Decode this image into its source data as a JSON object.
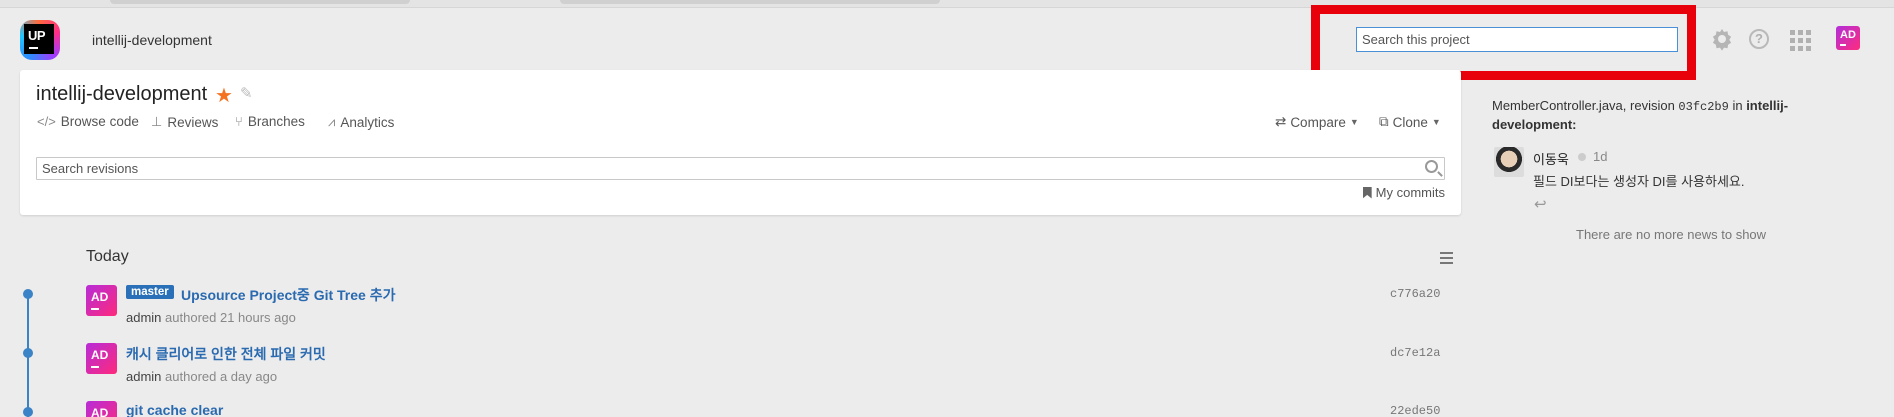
{
  "header": {
    "project_name": "intellij-development",
    "search_placeholder": "Search this project",
    "help_glyph": "?",
    "user_initials": "AD",
    "icons": [
      "upsource-logo",
      "settings-icon",
      "help-icon",
      "apps-grid-icon"
    ]
  },
  "project": {
    "title": "intellij-development",
    "nav": [
      {
        "label": "Browse code",
        "icon": "code-icon"
      },
      {
        "label": "Reviews",
        "icon": "reviews-icon"
      },
      {
        "label": "Branches",
        "icon": "branch-icon"
      },
      {
        "label": "Analytics",
        "icon": "analytics-icon"
      }
    ],
    "compare_label": "Compare",
    "clone_label": "Clone",
    "revision_search_placeholder": "Search revisions",
    "my_commits_label": "My commits"
  },
  "news": {
    "file": "MemberController.java",
    "revision_word": ", revision ",
    "revision": "03fc2b9",
    "in_word": " in ",
    "project": "intellij-development:",
    "author": "이동욱",
    "time": "1d",
    "comment": "필드 DI보다는 생성자 DI를 사용하세요.",
    "empty_text": "There are no more news to show"
  },
  "timeline": {
    "group_label": "Today",
    "commits": [
      {
        "initials": "AD",
        "branch": "master",
        "title": "Upsource Project중 Git Tree 추가",
        "author": "admin",
        "meta": " authored 21 hours ago",
        "hash": "c776a20"
      },
      {
        "initials": "AD",
        "branch": "",
        "title": "캐시 클리어로 인한 전체 파일 커밋",
        "author": "admin",
        "meta": " authored a day ago",
        "hash": "dc7e12a"
      },
      {
        "initials": "AD",
        "branch": "",
        "title": "git cache clear",
        "author": "",
        "meta": "",
        "hash": "22ede50"
      }
    ]
  },
  "colors": {
    "accent": "#2a6ab0",
    "highlight_box": "#e8000b",
    "star": "#f47321",
    "avatar_gradient": [
      "#b62cd8",
      "#ff2a7b"
    ]
  }
}
